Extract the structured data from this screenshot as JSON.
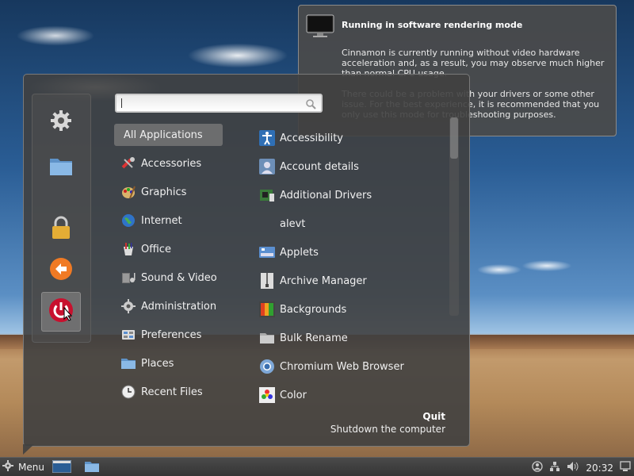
{
  "notification": {
    "title": "Running in software rendering mode",
    "body1": "Cinnamon is currently running without video hardware acceleration and, as a result, you may observe much higher than normal CPU usage.",
    "body2": "There could be a problem with your drivers or some other issue. For the best experience, it is recommended that you only use this mode for troubleshooting purposes."
  },
  "menu": {
    "search": {
      "value": "",
      "placeholder": ""
    },
    "favorites": [
      {
        "name": "settings",
        "icon": "gear-icon"
      },
      {
        "name": "files",
        "icon": "folder-icon"
      },
      {
        "name": "lock",
        "icon": "lock-icon"
      },
      {
        "name": "logout",
        "icon": "logout-icon"
      },
      {
        "name": "shutdown",
        "icon": "power-icon"
      }
    ],
    "categories": [
      {
        "label": "All Applications"
      },
      {
        "label": "Accessories",
        "icon": "accessories-icon"
      },
      {
        "label": "Graphics",
        "icon": "graphics-icon"
      },
      {
        "label": "Internet",
        "icon": "internet-icon"
      },
      {
        "label": "Office",
        "icon": "office-icon"
      },
      {
        "label": "Sound & Video",
        "icon": "sound-video-icon"
      },
      {
        "label": "Administration",
        "icon": "administration-icon"
      },
      {
        "label": "Preferences",
        "icon": "preferences-icon"
      },
      {
        "label": "Places",
        "icon": "places-icon"
      },
      {
        "label": "Recent Files",
        "icon": "recent-files-icon"
      }
    ],
    "apps": [
      {
        "label": "Accessibility",
        "icon": "accessibility-icon"
      },
      {
        "label": "Account details",
        "icon": "account-icon"
      },
      {
        "label": "Additional Drivers",
        "icon": "drivers-icon"
      },
      {
        "label": "alevt",
        "icon": ""
      },
      {
        "label": "Applets",
        "icon": "applets-icon"
      },
      {
        "label": "Archive Manager",
        "icon": "archive-icon"
      },
      {
        "label": "Backgrounds",
        "icon": "backgrounds-icon"
      },
      {
        "label": "Bulk Rename",
        "icon": "rename-icon"
      },
      {
        "label": "Chromium Web Browser",
        "icon": "chromium-icon"
      },
      {
        "label": "Color",
        "icon": "color-icon"
      }
    ],
    "quit": {
      "title": "Quit",
      "description": "Shutdown the computer"
    }
  },
  "panel": {
    "menu_label": "Menu",
    "clock": "20:32"
  }
}
